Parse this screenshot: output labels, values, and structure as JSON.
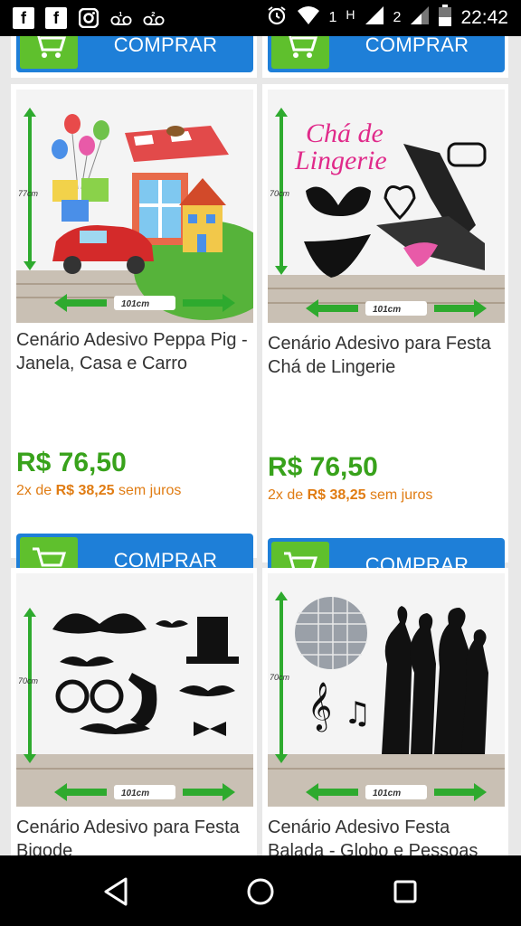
{
  "status_bar": {
    "time": "22:42",
    "sim1": "1",
    "sim2": "2",
    "network": "H",
    "icons": [
      "facebook-icon",
      "facebook-icon",
      "instagram-icon",
      "voicemail-icon",
      "voicemail-icon",
      "alarm-icon",
      "wifi-icon",
      "signal-icon",
      "signal-icon",
      "battery-icon"
    ]
  },
  "products": [
    {
      "id": "top-left",
      "button": "COMPRAR"
    },
    {
      "id": "top-right",
      "button": "COMPRAR"
    },
    {
      "id": "p1",
      "title": "Cenário Adesivo Peppa Pig - Janela, Casa e Carro",
      "price": "R$ 76,50",
      "installment_prefix": "2x de",
      "installment_value": "R$ 38,25",
      "installment_suffix": "sem juros",
      "button": "COMPRAR",
      "dim_h": "77cm",
      "dim_w": "101cm"
    },
    {
      "id": "p2",
      "title": "Cenário Adesivo para Festa Chá de Lingerie",
      "price": "R$ 76,50",
      "installment_prefix": "2x de",
      "installment_value": "R$ 38,25",
      "installment_suffix": "sem juros",
      "button": "COMPRAR",
      "dim_h": "70cm",
      "dim_w": "101cm",
      "art_text_1": "Chá de",
      "art_text_2": "Lingerie"
    },
    {
      "id": "p3",
      "title": "Cenário Adesivo para Festa Bigode",
      "dim_h": "70cm",
      "dim_w": "101cm"
    },
    {
      "id": "p4",
      "title": "Cenário Adesivo Festa Balada - Globo e Pessoas",
      "dim_h": "70cm",
      "dim_w": "101cm"
    }
  ],
  "nav": {
    "back": "back-icon",
    "home": "home-icon",
    "recents": "recents-icon"
  },
  "colors": {
    "button_blue": "#1e7fd8",
    "cart_green": "#5fc02d",
    "price_green": "#38a21b",
    "installment_orange": "#e07c13"
  }
}
